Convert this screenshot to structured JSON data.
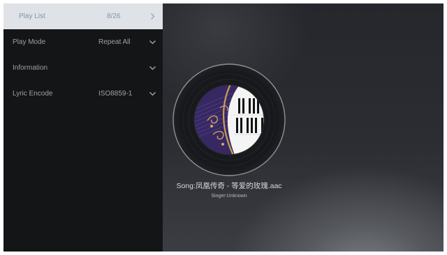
{
  "menu": {
    "items": [
      {
        "label": "Play List",
        "value": "8/26",
        "icon": "chevron-right-icon"
      },
      {
        "label": "Play Mode",
        "value": "Repeat All",
        "icon": "chevron-down-icon"
      },
      {
        "label": "Information",
        "value": "",
        "icon": "chevron-down-icon"
      },
      {
        "label": "Lyric Encode",
        "value": "ISO8859-1",
        "icon": "chevron-down-icon"
      }
    ]
  },
  "player": {
    "song": "Song:凤凰传奇 - 等爱的玫瑰.aac",
    "singer": "Singer:Unknown",
    "album_art": "vinyl-disc-piano-keys-gold-notes"
  },
  "colors": {
    "menu_bg": "#141517",
    "menu_selected_bg": "#dfe2e6",
    "menu_selected_text": "#7f96ad",
    "menu_text": "#9ea0a4",
    "art_purple": "#3a2a66",
    "art_gold": "#c9a050"
  }
}
